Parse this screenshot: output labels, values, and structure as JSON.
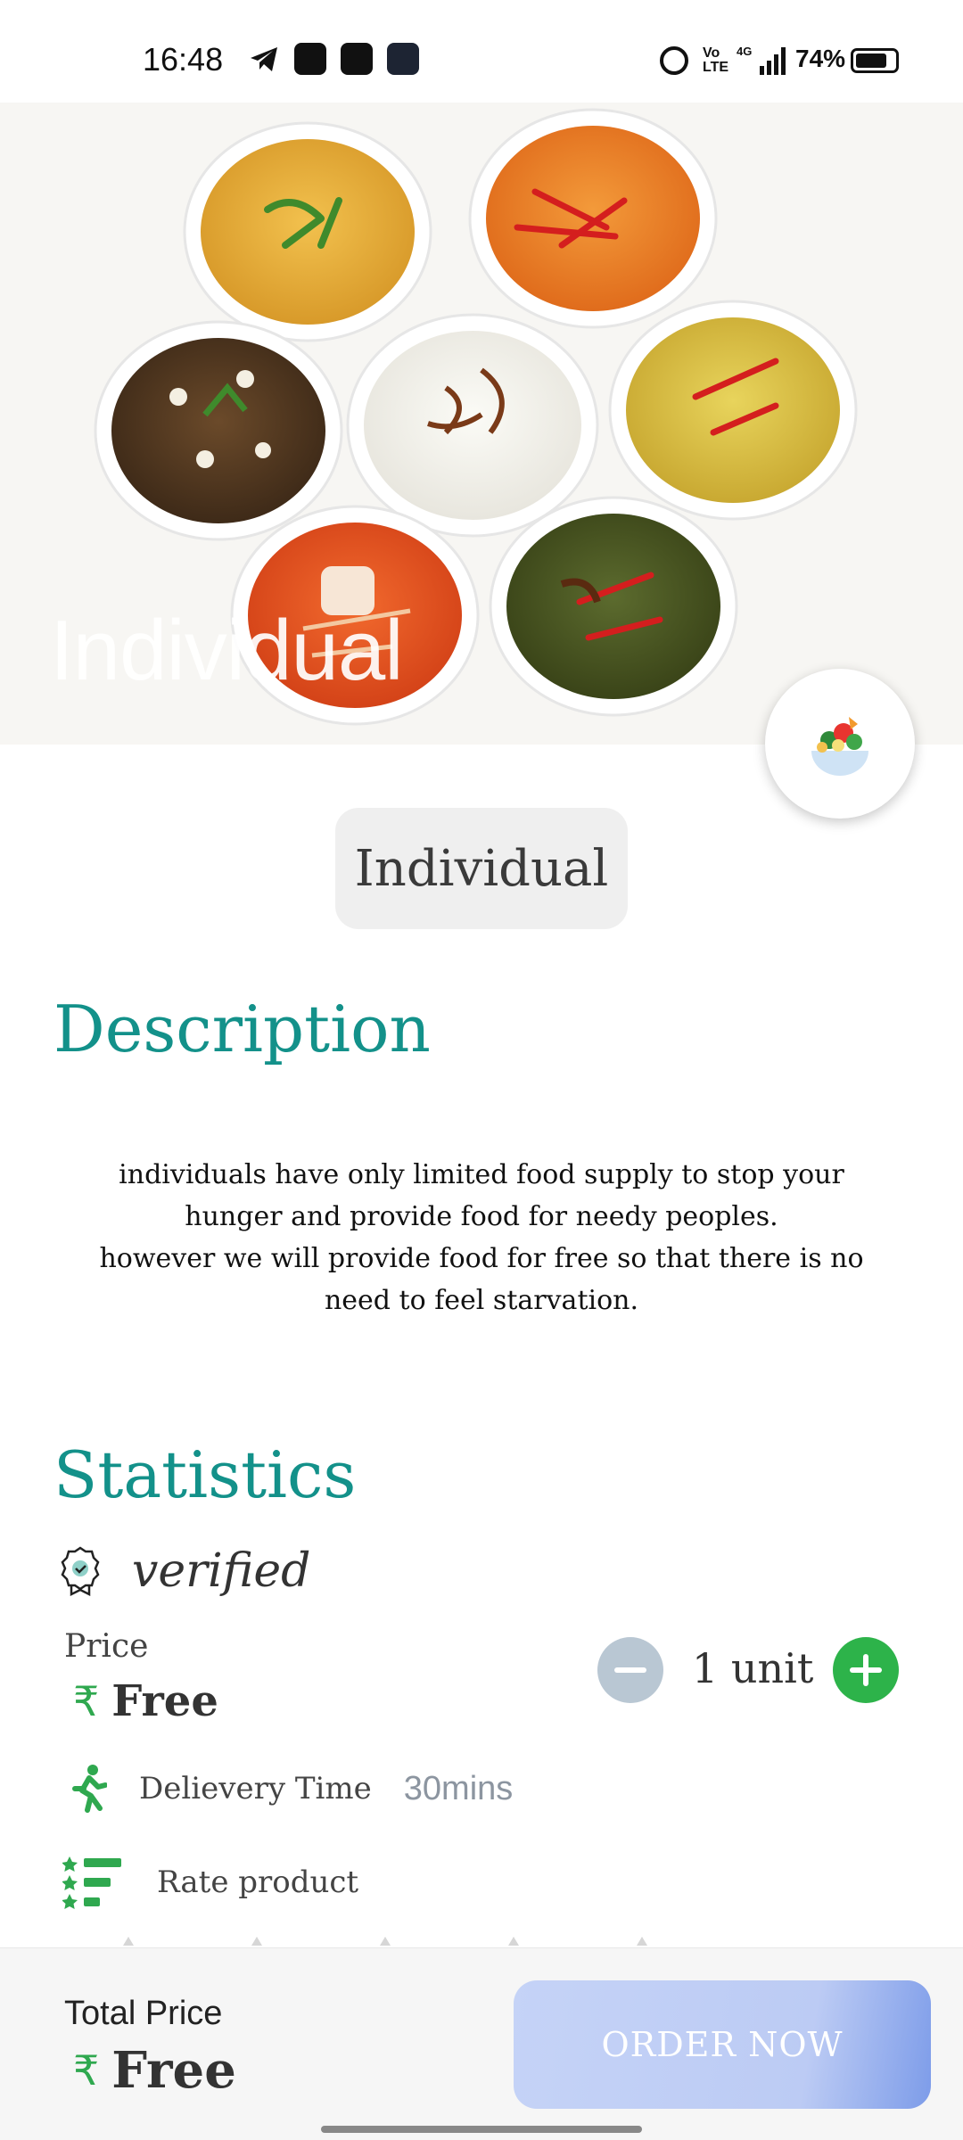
{
  "status_bar": {
    "time": "16:48",
    "network": "4G",
    "volte": "Vo LTE",
    "battery": "74%",
    "icons": [
      "telegram-icon",
      "zomato-icon",
      "app-icon",
      "app-icon",
      "alarm-icon",
      "signal-icon",
      "battery-icon"
    ]
  },
  "hero": {
    "title": "Individual",
    "image": "bowls-of-indian-curries-and-rice"
  },
  "fab": {
    "icon": "salad-bowl-icon"
  },
  "chip": {
    "label": "Individual"
  },
  "description": {
    "title": "Description",
    "line1": "individuals have only limited food supply to stop your hunger and provide food for needy peoples.",
    "line2": "however we will provide food for free so that there is no need to feel starvation."
  },
  "statistics": {
    "title": "Statistics",
    "verified": "verified",
    "price_label": "Price",
    "price_value": "Free",
    "currency_symbol": "₹",
    "quantity": "1 unit",
    "delivery_label": "Delievery Time",
    "delivery_value": "30mins",
    "rate_label": "Rate product"
  },
  "bottom_bar": {
    "total_label": "Total Price",
    "total_value": "Free",
    "currency_symbol": "₹",
    "order_button": "ORDER NOW"
  },
  "colors": {
    "accent_teal": "#13918a",
    "green": "#2db34a",
    "minus_grey": "#b9c7d3",
    "order_gradient_start": "#c5d3f7",
    "order_gradient_end": "#7d9ce9"
  }
}
